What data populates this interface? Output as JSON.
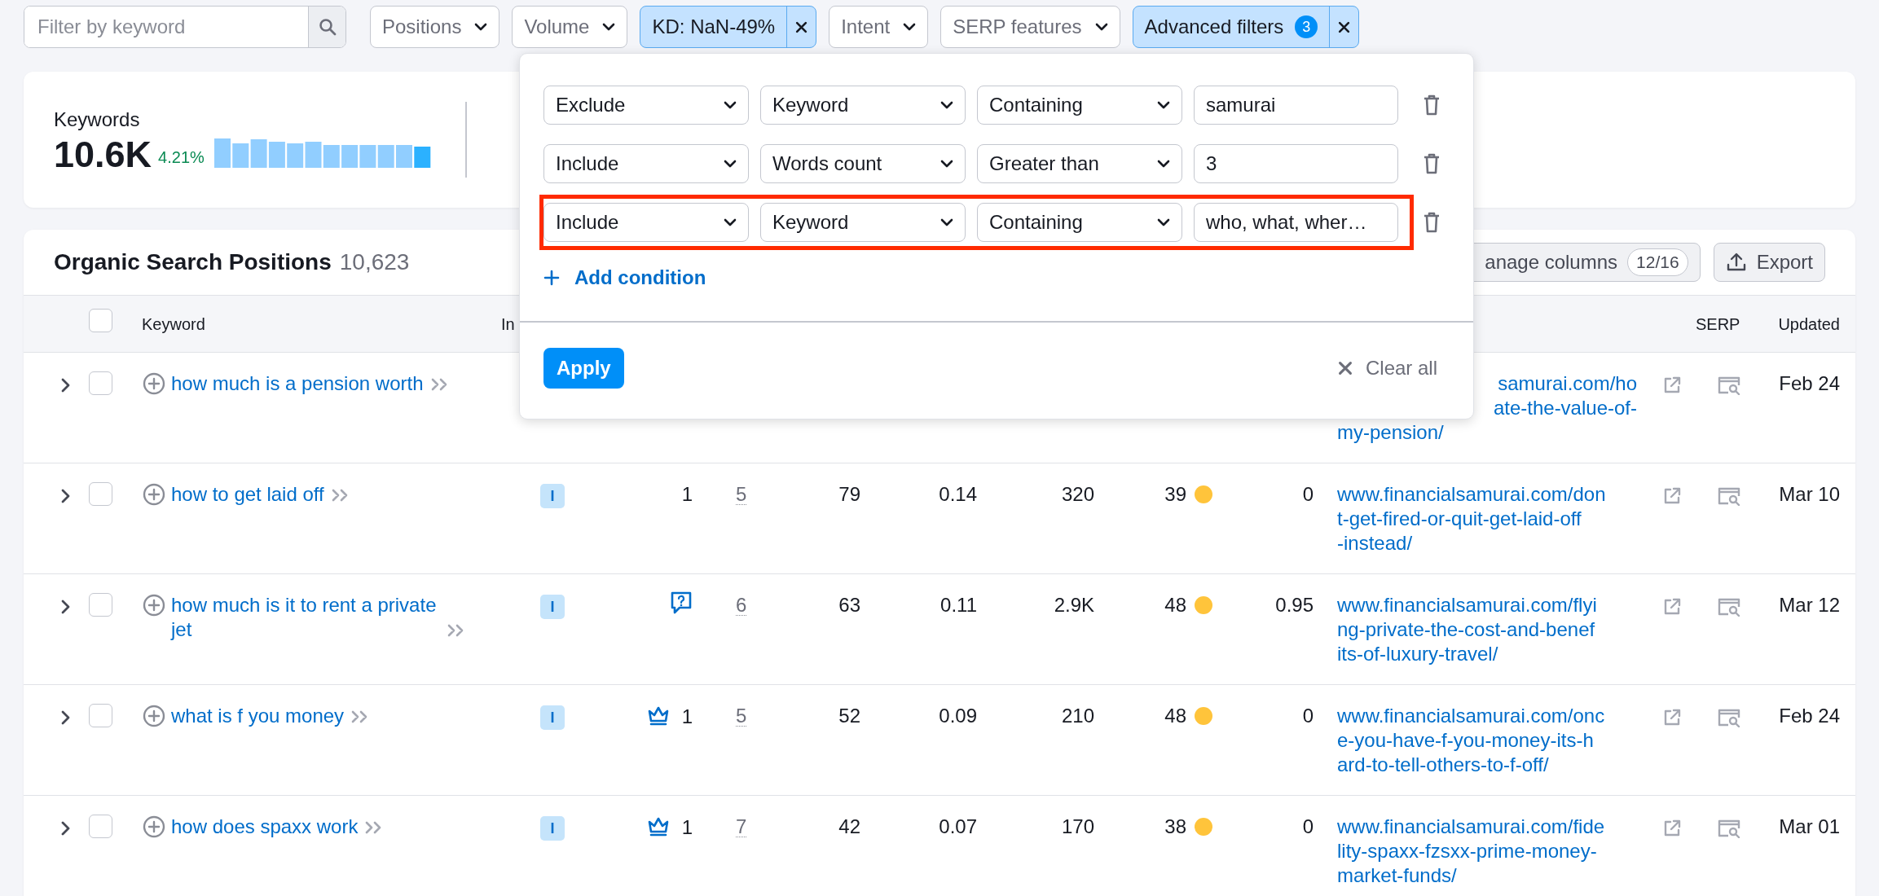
{
  "filter_bar": {
    "search": {
      "placeholder": "Filter by keyword"
    },
    "filters": [
      {
        "label": "Positions",
        "active": false
      },
      {
        "label": "Volume",
        "active": false
      },
      {
        "label": "KD: NaN-49%",
        "active": true
      },
      {
        "label": "Intent",
        "active": false
      },
      {
        "label": "SERP features",
        "active": false
      },
      {
        "label": "Advanced filters",
        "active": true,
        "badge": "3"
      }
    ]
  },
  "summary": {
    "label": "Keywords",
    "value": "10.6K",
    "change": "4.21%"
  },
  "table_card": {
    "title": "Organic Search Positions",
    "count": "10,623",
    "buttons": [
      {
        "kind": "columns",
        "label": "anage columns",
        "badge": "12/16"
      },
      {
        "kind": "export",
        "label": "Export"
      }
    ],
    "header": {
      "checked": false,
      "keyword": "Keyword",
      "column_2": "In",
      "serp": "SERP",
      "updated": "Updated"
    },
    "rows": [
      {
        "checked": false,
        "kind": "plain",
        "keyword": "how much is a pension worth",
        "column_10": [
          "samurai.com/ho",
          "ate-the-value-of-",
          "my-pension/"
        ],
        "covered": true,
        "updated": "Feb 24"
      },
      {
        "checked": false,
        "kind": "plain",
        "keyword": "how to get laid off",
        "intent": "I",
        "column_3": "1",
        "column_4": "5",
        "column_5": "79",
        "column_6": "0.14",
        "column_7": "320",
        "column_8": "39",
        "color": "#ffc43b",
        "column_9": "0",
        "column_10": [
          "www.financialsamurai.com/don",
          "t-get-fired-or-quit-get-laid-off",
          "-instead/"
        ],
        "covered": false,
        "updated": "Mar 10"
      },
      {
        "checked": false,
        "keyword": "how much is it to rent a private jet",
        "kind": "question",
        "intent": "I",
        "column_4": "6",
        "column_5": "63",
        "column_6": "0.11",
        "column_7": "2.9K",
        "column_8": "48",
        "color": "#ffc43b",
        "column_9": "0.95",
        "column_10": [
          "www.financialsamurai.com/flyi",
          "ng-private-the-cost-and-benef",
          "its-of-luxury-travel/"
        ],
        "covered": false,
        "updated": "Mar 12"
      },
      {
        "checked": false,
        "keyword": "what is f you money",
        "kind": "crown",
        "intent": "I",
        "column_3": "1",
        "column_4": "5",
        "column_5": "52",
        "column_6": "0.09",
        "column_7": "210",
        "column_8": "48",
        "color": "#ffc43b",
        "column_9": "0",
        "column_10": [
          "www.financialsamurai.com/onc",
          "e-you-have-f-you-money-its-h",
          "ard-to-tell-others-to-f-off/"
        ],
        "covered": false,
        "updated": "Feb 24"
      },
      {
        "checked": false,
        "keyword": "how does spaxx work",
        "kind": "crown",
        "intent": "I",
        "column_3": "1",
        "column_4": "7",
        "column_5": "42",
        "column_6": "0.07",
        "column_7": "170",
        "column_8": "38",
        "color": "#ffc43b",
        "column_9": "0",
        "column_10": [
          "www.financialsamurai.com/fide",
          "lity-spaxx-fzsxx-prime-money-",
          "market-funds/"
        ],
        "covered": false,
        "updated": "Mar 01"
      }
    ]
  },
  "advanced_filters_popup": {
    "conditions": [
      {
        "mode": "Exclude",
        "field": "Keyword",
        "operator": "Containing",
        "value": "samurai",
        "highlighted": false
      },
      {
        "mode": "Include",
        "field": "Words count",
        "operator": "Greater than",
        "value": "3",
        "highlighted": false
      },
      {
        "mode": "Include",
        "field": "Keyword",
        "operator": "Containing",
        "value": "who, what, wher…",
        "highlighted": true
      }
    ],
    "add_condition": "Add condition",
    "apply": "Apply",
    "clear_all": "Clear all"
  }
}
